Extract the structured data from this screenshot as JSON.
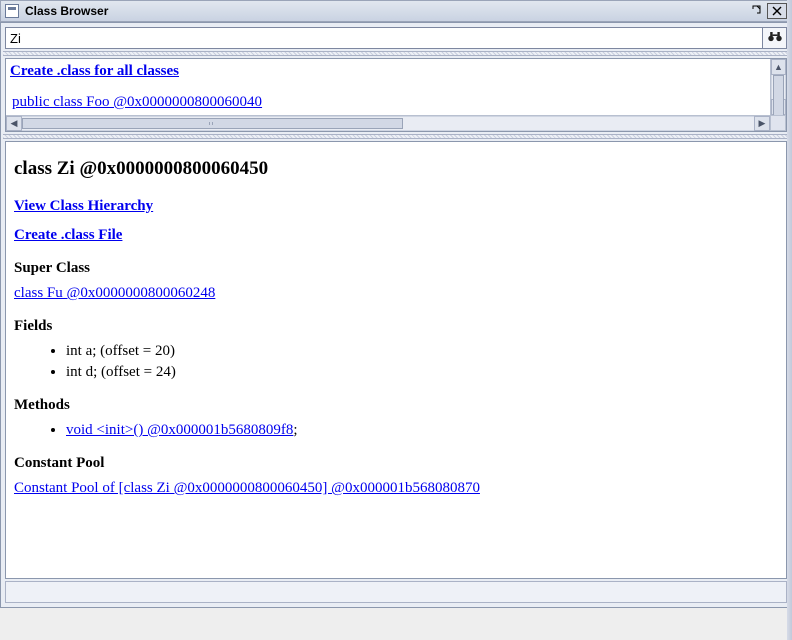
{
  "window": {
    "title": "Class Browser"
  },
  "search": {
    "value": "Zi"
  },
  "upper": {
    "create_all_label": "Create .class for all classes",
    "result_line": "public class Foo @0x0000000800060040"
  },
  "detail": {
    "heading": "class Zi @0x0000000800060450",
    "view_hierarchy": "View Class Hierarchy",
    "create_class_file": "Create .class File",
    "super_class_h": "Super Class",
    "super_class_link": "class Fu @0x0000000800060248",
    "fields_h": "Fields",
    "fields": [
      "int a; (offset = 20)",
      "int d; (offset = 24)"
    ],
    "methods_h": "Methods",
    "methods": [
      {
        "link": "void <init>() @0x000001b5680809f8",
        "suffix": ";"
      }
    ],
    "constpool_h": "Constant Pool",
    "constpool_link": "Constant Pool of [class Zi @0x0000000800060450] @0x000001b568080870"
  }
}
